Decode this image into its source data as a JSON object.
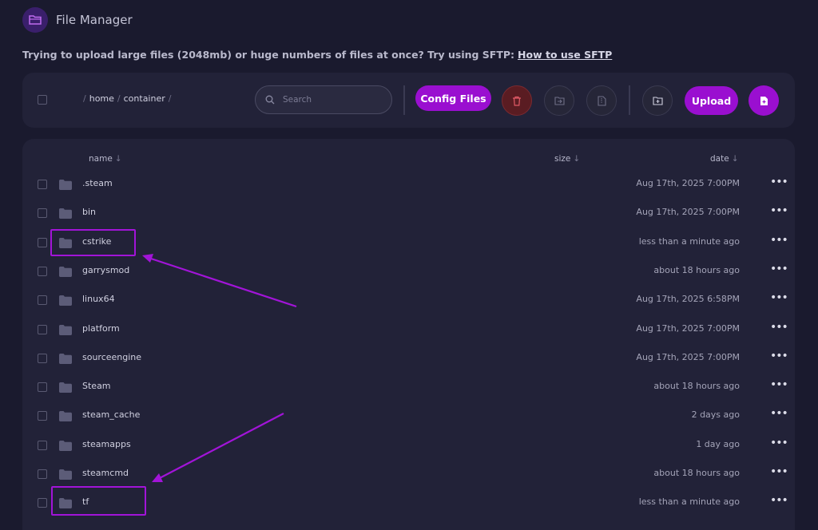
{
  "header": {
    "title": "File Manager",
    "icon": "folder-open-icon"
  },
  "notice": {
    "text": "Trying to upload large files (2048mb) or huge numbers of files at once? Try using SFTP:",
    "link": "How to use SFTP"
  },
  "toolbar": {
    "breadcrumb": [
      "home",
      "container"
    ],
    "search_placeholder": "Search",
    "config_label": "Config Files",
    "upload_label": "Upload"
  },
  "table": {
    "columns": {
      "name": "name",
      "size": "size",
      "date": "date"
    },
    "rows": [
      {
        "name": ".steam",
        "date": "Aug 17th, 2025 7:00PM"
      },
      {
        "name": "bin",
        "date": "Aug 17th, 2025 7:00PM"
      },
      {
        "name": "cstrike",
        "date": "less than a minute ago"
      },
      {
        "name": "garrysmod",
        "date": "about 18 hours ago"
      },
      {
        "name": "linux64",
        "date": "Aug 17th, 2025 6:58PM"
      },
      {
        "name": "platform",
        "date": "Aug 17th, 2025 7:00PM"
      },
      {
        "name": "sourceengine",
        "date": "Aug 17th, 2025 7:00PM"
      },
      {
        "name": "Steam",
        "date": "about 18 hours ago"
      },
      {
        "name": "steam_cache",
        "date": "2 days ago"
      },
      {
        "name": "steamapps",
        "date": "1 day ago"
      },
      {
        "name": "steamcmd",
        "date": "about 18 hours ago"
      },
      {
        "name": "tf",
        "date": "less than a minute ago"
      }
    ]
  },
  "colors": {
    "accent": "#9a0fd0",
    "background": "#1a1a2e",
    "panel": "#222238",
    "danger": "#5a1c22",
    "annotation": "#a214d8"
  }
}
